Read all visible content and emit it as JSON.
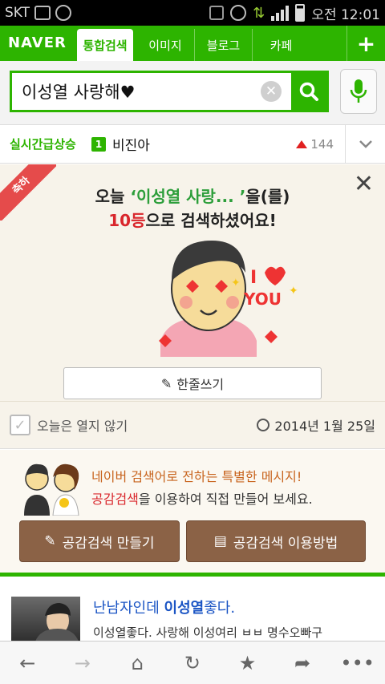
{
  "status_bar": {
    "carrier": "SKT",
    "time": "오전 12:01"
  },
  "nav": {
    "logo": "NAVER",
    "tabs": [
      {
        "label": "통합검색",
        "active": true
      },
      {
        "label": "이미지"
      },
      {
        "label": "블로그"
      },
      {
        "label": "카페"
      }
    ],
    "plus": "+"
  },
  "search": {
    "value": "이성열 사랑해♥",
    "clear_symbol": "✕"
  },
  "trending": {
    "label": "실시간급상승",
    "rank": "1",
    "keyword": "비진아",
    "count": "144"
  },
  "congrats": {
    "ribbon": "축하",
    "close": "✕",
    "line1_prefix": "오늘 ",
    "line1_highlight": "‘이성열 사랑...  ’",
    "line1_suffix": "을(를)",
    "line2_rank": "10등",
    "line2_suffix": "으로 검색하셨어요!",
    "sticker_text1": "I",
    "sticker_text2": "YOU",
    "write_button": "한줄쓰기"
  },
  "options": {
    "dont_open_today": "오늘은 열지 않기",
    "date": "2014년 1월 25일"
  },
  "empathy": {
    "line1": "네이버 검색어로 전하는 특별한 메시지!",
    "line2_highlight": "공감검색",
    "line2_suffix": "을 이용하여 직접 만들어 보세요.",
    "make_button": "공감검색 만들기",
    "howto_button": "공감검색 이용방법"
  },
  "result": {
    "title_prefix": "난남자인데 ",
    "title_bold": "이성열",
    "title_suffix": "좋다.",
    "snippet": "이성열좋다. 사랑해 이성여리 ㅂㅂ 명수오빠구"
  },
  "bottom_nav": {
    "back": "←",
    "forward": "→",
    "home": "⌂",
    "refresh": "↻",
    "star": "★",
    "share": "➦",
    "more": "•••"
  }
}
